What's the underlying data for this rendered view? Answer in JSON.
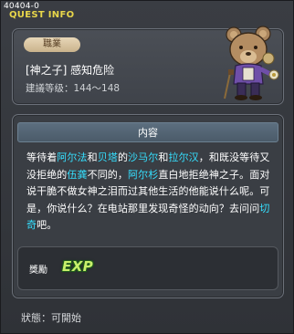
{
  "window": {
    "quest_id": "40404-0",
    "title": "QUEST INFO"
  },
  "quest": {
    "job_tag": "職業",
    "name": "[神之子] 感知危险",
    "level_requirement": "建議等级：144～148"
  },
  "content": {
    "header": "内容",
    "description_parts": [
      {
        "t": "等待着",
        "hl": false
      },
      {
        "t": "阿尔法",
        "hl": true
      },
      {
        "t": "和",
        "hl": false
      },
      {
        "t": "贝塔",
        "hl": true
      },
      {
        "t": "的",
        "hl": false
      },
      {
        "t": "沙马尔",
        "hl": true
      },
      {
        "t": "和",
        "hl": false
      },
      {
        "t": "拉尔汉",
        "hl": true
      },
      {
        "t": "，和既没等待又没拒绝的",
        "hl": false
      },
      {
        "t": "伍龚",
        "hl": true
      },
      {
        "t": "不同的，",
        "hl": false
      },
      {
        "t": "阿尔杉",
        "hl": true
      },
      {
        "t": "直白地拒绝神之子。面对说干脆不做女神之泪而过其他生活的他能说什么呢。可是，你说什么？在电站那里发现奇怪的动向？去问问",
        "hl": false
      },
      {
        "t": "切奇",
        "hl": true
      },
      {
        "t": "吧。",
        "hl": false
      }
    ]
  },
  "reward": {
    "label": "獎勵",
    "exp_icon_text": "EXP"
  },
  "status": {
    "text": "狀態：可開始"
  },
  "colors": {
    "highlight": "#35e0ff",
    "title": "#e8d64a",
    "header_bg": "#5c6f7f"
  }
}
